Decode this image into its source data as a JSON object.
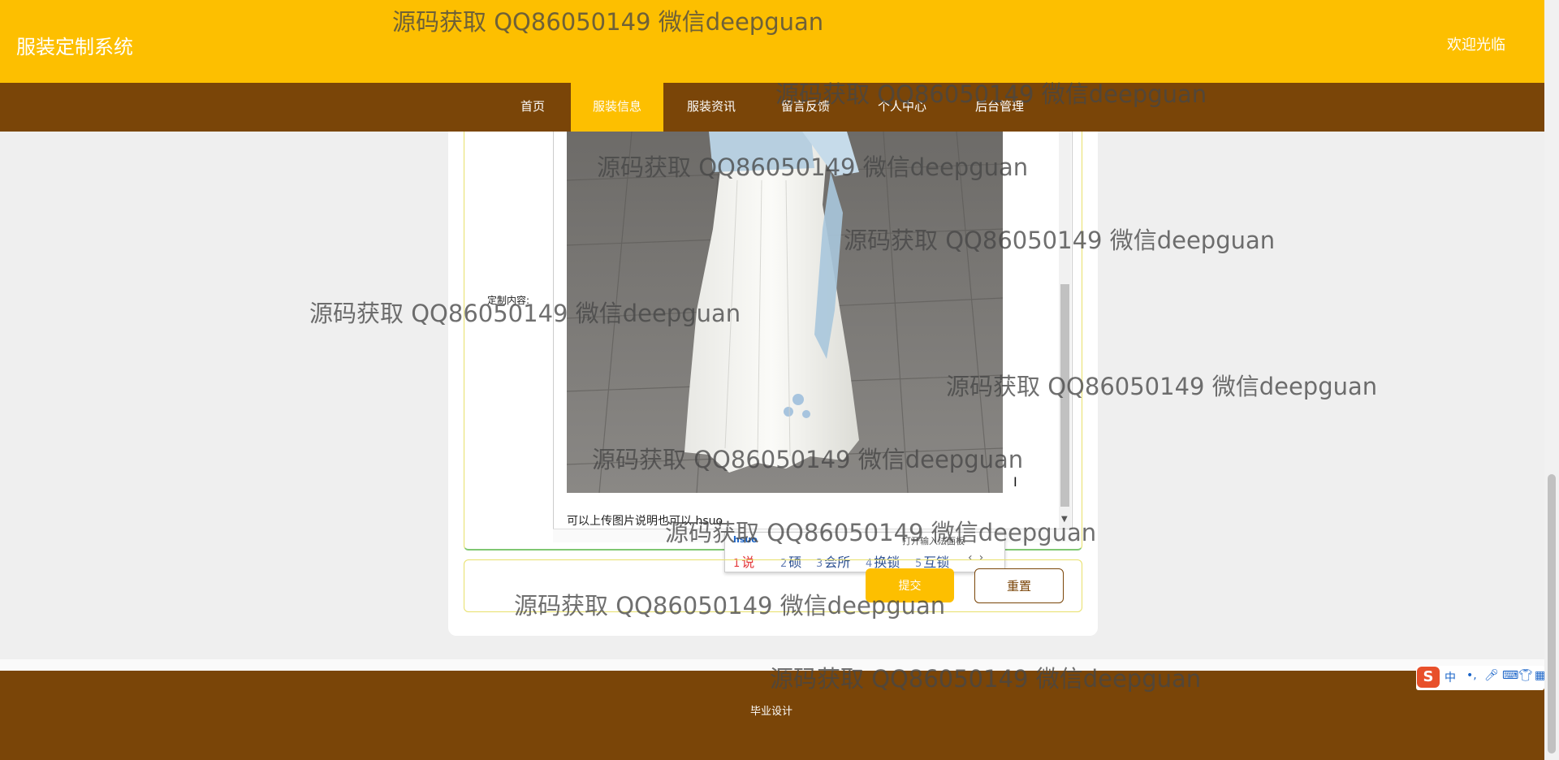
{
  "header": {
    "site_title": "服装定制系统",
    "welcome": "欢迎光临"
  },
  "nav": {
    "items": [
      {
        "label": "首页"
      },
      {
        "label": "服装信息"
      },
      {
        "label": "服装资讯"
      },
      {
        "label": "留言反馈"
      },
      {
        "label": "个人中心"
      },
      {
        "label": "后台管理"
      }
    ],
    "active_index": 1
  },
  "form": {
    "content_label": "定制内容:",
    "editor_text": "可以上传图片说明也可以 hsuo",
    "submit_label": "提交",
    "reset_label": "重置"
  },
  "ime": {
    "pinyin": "hsuo",
    "hint": "打开输入法面板",
    "candidates": [
      {
        "index": "1",
        "text": "说"
      },
      {
        "index": "2",
        "text": "硕"
      },
      {
        "index": "3",
        "text": "会所"
      },
      {
        "index": "4",
        "text": "换锁"
      },
      {
        "index": "5",
        "text": "互锁"
      }
    ],
    "arrows": "‹›"
  },
  "footer": {
    "text": "毕业设计"
  },
  "tray": {
    "logo": "S",
    "mode": "中",
    "icons": [
      "punctuation-icon",
      "microphone-icon",
      "keyboard-icon",
      "skin-icon",
      "toolbox-icon"
    ]
  },
  "watermark": "源码获取 QQ86050149 微信deepguan",
  "colors": {
    "primary": "#fdbf00",
    "nav_brown": "#7a4508",
    "background": "#efefef"
  }
}
